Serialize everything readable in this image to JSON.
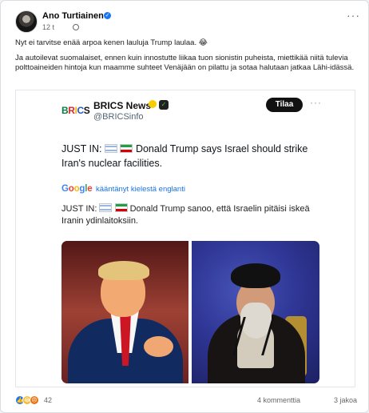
{
  "post": {
    "author": "Ano Turtiainen",
    "time": "12 t",
    "more": "···",
    "paragraphs": [
      "Nyt ei tarvitse enää arpoa kenen lauluja Trump laulaa. 😂",
      "Ja autoilevat suomalaiset, ennen kuin innostutte liikaa tuon sionistin puheista, miettikää niitä tulevia polttoaineiden hintoja kun maamme suhteet Venäjään on pilattu ja sotaa halutaan jatkaa Lähi-idässä."
    ]
  },
  "embed": {
    "logo": [
      "B",
      "R",
      "I",
      "C",
      "S"
    ],
    "name": "BRICS News",
    "handle": "@BRICSinfo",
    "follow_label": "Tilaa",
    "more": "···",
    "prefix": "JUST IN:",
    "text": "Donald Trump says Israel should strike Iran's nuclear facilities.",
    "translation_logo": [
      "G",
      "o",
      "o",
      "g",
      "l",
      "e"
    ],
    "translation_label": "kääntänyt kielestä englanti",
    "translated_prefix": "JUST IN:",
    "translated_text": "Donald Trump sanoo, että Israelin pitäisi iskeä Iranin ydinlaitoksiin."
  },
  "reactions": {
    "count": "42",
    "comments": "4 kommenttia",
    "shares": "3 jakoa"
  }
}
